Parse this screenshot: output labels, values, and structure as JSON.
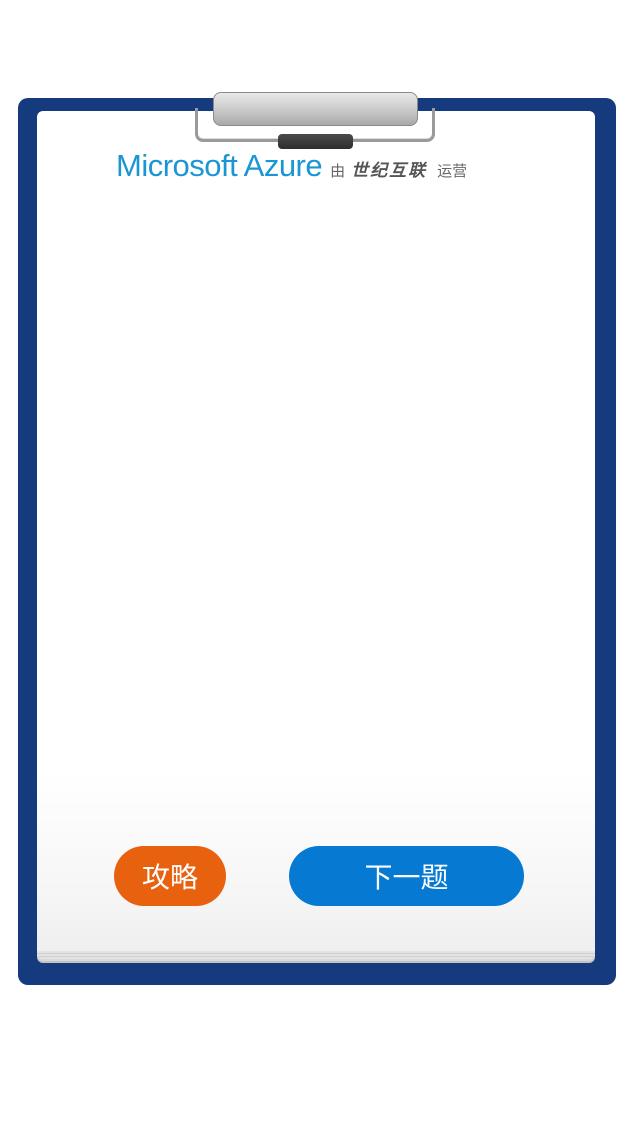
{
  "logo": {
    "brand": "Microsoft Azure",
    "by": "由",
    "partner": "世纪互联",
    "operated": "运营"
  },
  "buttons": {
    "guide_label": "攻略",
    "next_label": "下一题"
  },
  "colors": {
    "board": "#163a7e",
    "guide_button": "#e8610f",
    "next_button": "#0679d3",
    "brand": "#1a96d4"
  }
}
